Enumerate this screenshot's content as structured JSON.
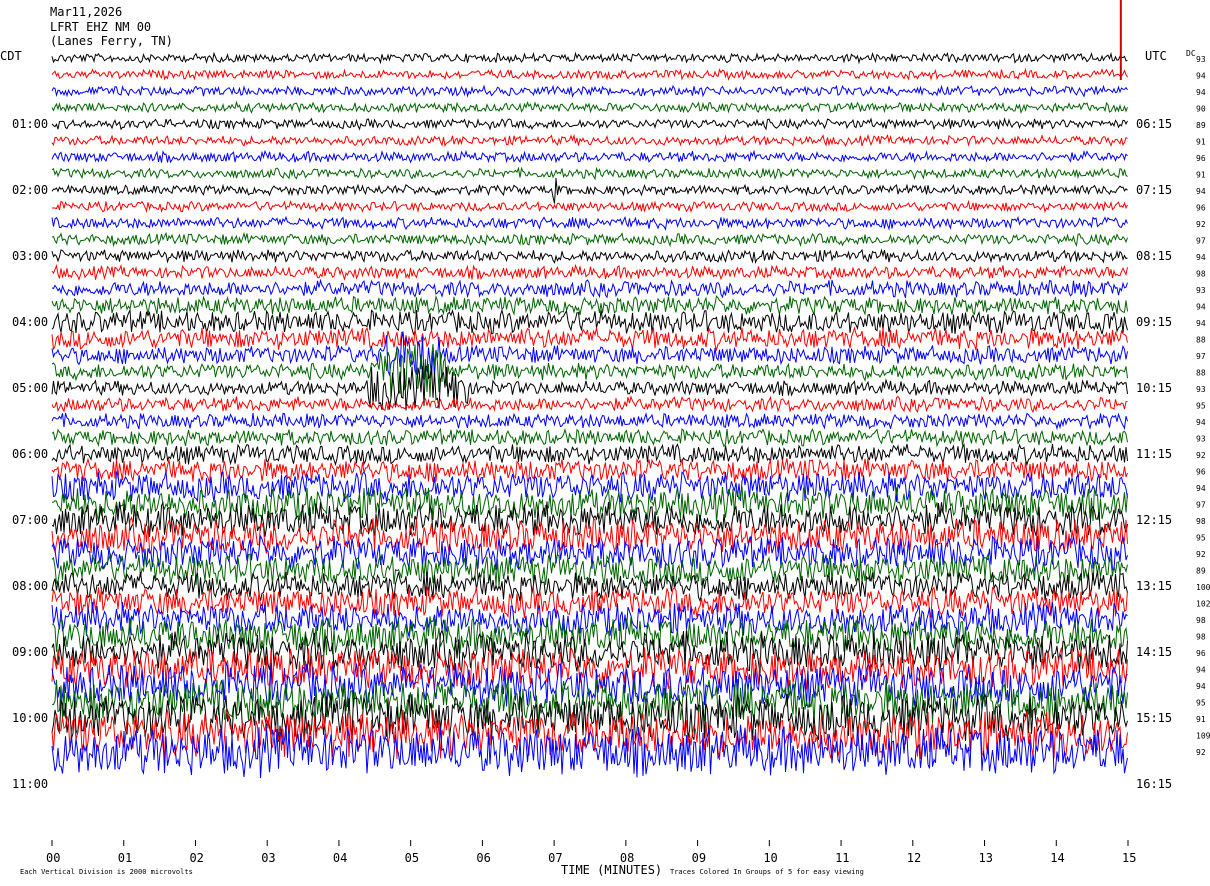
{
  "header": {
    "date": "Mar11,2026",
    "station": "LFRT EHZ NM 00",
    "location": "(Lanes Ferry, TN)"
  },
  "axes": {
    "left_zone": "CDT",
    "right_zone": "UTC",
    "dc_label": "DC",
    "xlabel": "TIME (MINUTES)",
    "footer_left": "Each Vertical Division is 2000 microvolts",
    "footer_right": "Traces Colored In Groups of 5 for easy viewing"
  },
  "chart_data": {
    "type": "line",
    "title": "LFRT EHZ NM 00 (Lanes Ferry, TN)",
    "xlabel": "TIME (MINUTES)",
    "ylabel": "",
    "xlim": [
      0,
      15
    ],
    "x_ticks": [
      "00",
      "01",
      "02",
      "03",
      "04",
      "05",
      "06",
      "07",
      "08",
      "09",
      "10",
      "11",
      "12",
      "13",
      "14",
      "15"
    ],
    "left_ticks": [
      "01:00",
      "02:00",
      "03:00",
      "04:00",
      "05:00",
      "06:00",
      "07:00",
      "08:00",
      "09:00",
      "10:00",
      "11:00"
    ],
    "right_ticks": [
      "06:15",
      "07:15",
      "08:15",
      "09:15",
      "10:15",
      "11:15",
      "12:15",
      "13:15",
      "14:15",
      "15:15",
      "16:15"
    ],
    "trace_colors": [
      "#000000",
      "#ff0000",
      "#0000ff",
      "#006400"
    ],
    "dc_values": [
      93,
      94,
      94,
      90,
      89,
      91,
      96,
      91,
      94,
      96,
      92,
      97,
      94,
      98,
      93,
      94,
      94,
      88,
      97,
      88,
      93,
      95,
      94,
      93,
      92,
      96,
      94,
      97,
      98,
      95,
      92,
      89,
      100,
      102,
      98,
      98,
      96,
      94,
      94,
      95,
      91,
      109,
      92
    ],
    "amplitude_levels": [
      0.55,
      0.55,
      0.6,
      0.6,
      0.6,
      0.6,
      0.65,
      0.6,
      0.6,
      0.6,
      0.7,
      0.7,
      0.75,
      0.8,
      1.0,
      1.1,
      1.4,
      1.3,
      1.1,
      1.0,
      0.9,
      0.9,
      0.9,
      1.0,
      1.2,
      1.4,
      1.8,
      2.0,
      2.1,
      2.1,
      2.0,
      1.9,
      1.7,
      1.8,
      2.0,
      2.2,
      2.4,
      2.5,
      2.6,
      2.7,
      2.8,
      2.9,
      3.0
    ],
    "events": [
      {
        "row": 18,
        "x_minute": 4.6,
        "width_minutes": 0.8,
        "amplitude": 3.5
      },
      {
        "row": 19,
        "x_minute": 4.5,
        "width_minutes": 1.0,
        "amplitude": 4.0
      },
      {
        "row": 20,
        "x_minute": 4.4,
        "width_minutes": 1.4,
        "amplitude": 3.2
      },
      {
        "row": 8,
        "x_minute": 6.95,
        "width_minutes": 0.1,
        "amplitude": 2.0
      }
    ],
    "marker_minute": 14.9
  }
}
